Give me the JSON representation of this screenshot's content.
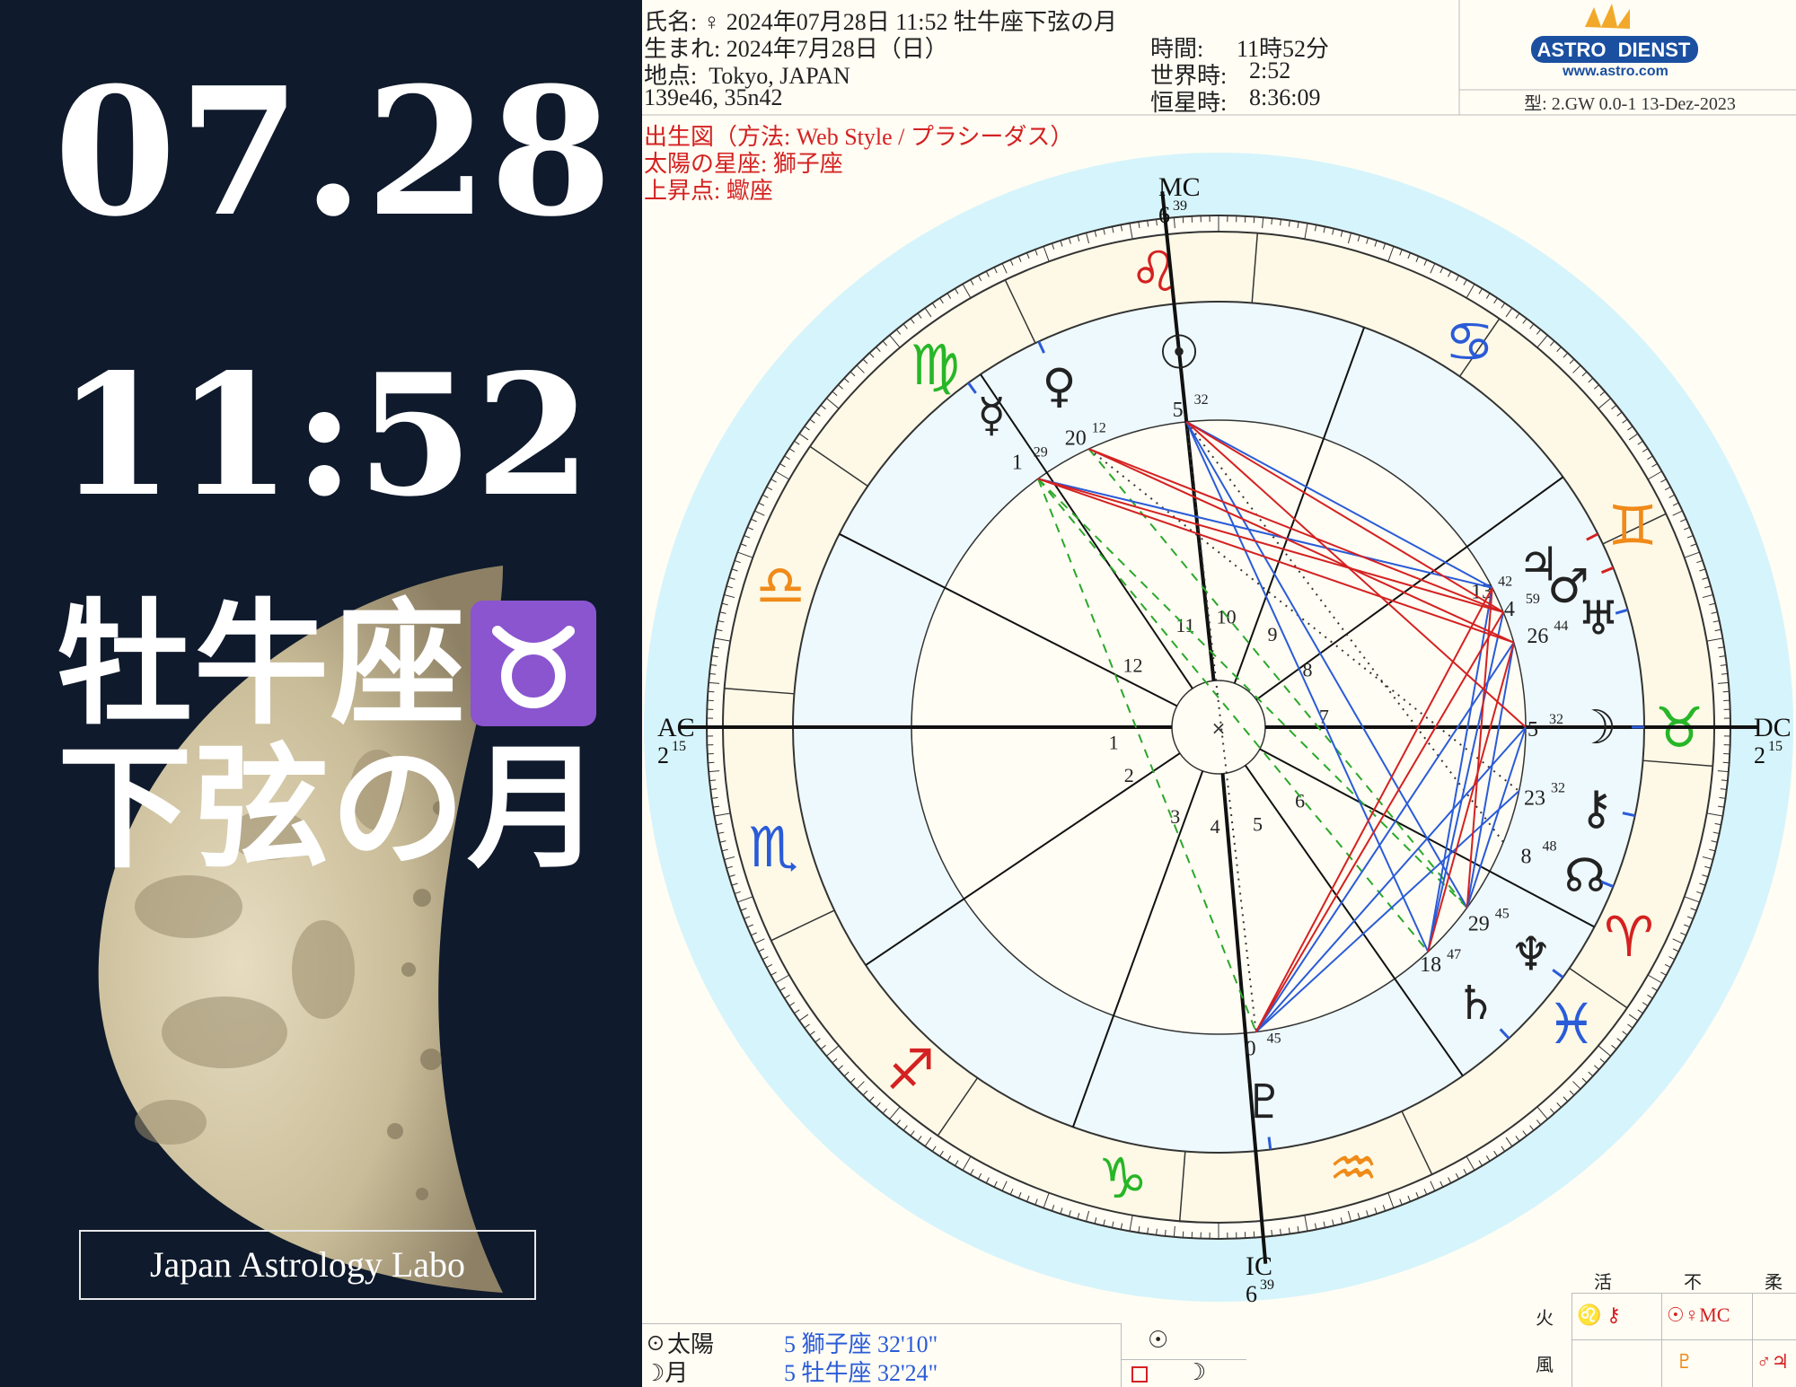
{
  "left": {
    "date": "07.28",
    "time": "11:52",
    "sign": "牡牛座",
    "sign_icon": "taurus-icon",
    "phase": "下弦の月",
    "brand": "Japan Astrology Labo"
  },
  "header": {
    "name_label": "氏名:",
    "name_value": "♀  2024年07月28日 11:52 牡牛座下弦の月",
    "born_label": "生まれ:",
    "born_value": "2024年7月28日（日）",
    "place_label": "地点:",
    "place_value": "Tokyo, JAPAN",
    "coords": "139e46, 35n42",
    "time_label": "時間:",
    "time_value": "11時52分",
    "ut_label": "世界時:",
    "ut_value": "2:52",
    "sidereal_label": "恒星時:",
    "sidereal_value": "8:36:09",
    "logo_left": "ASTRO",
    "logo_right": "DIENST",
    "logo_url": "www.astro.com",
    "type_line": "型: 2.GW   0.0-1   13-Dez-2023"
  },
  "chart_info": {
    "line1": "出生図（方法: Web Style / プラシーダス）",
    "line2": "太陽の星座: 獅子座",
    "line3": "上昇点: 蠍座"
  },
  "angles": {
    "mc_label": "MC",
    "mc_deg": "6",
    "mc_min": "39",
    "ic_label": "IC",
    "ic_deg": "6",
    "ic_min": "39",
    "ac_label": "AC",
    "ac_deg": "2",
    "ac_min": "15",
    "dc_label": "DC",
    "dc_deg": "2",
    "dc_min": "15"
  },
  "planets": [
    {
      "glyph": "☉",
      "deg": "5",
      "min": "32",
      "icon": "sun-icon"
    },
    {
      "glyph": "♀",
      "deg": "20",
      "min": "12",
      "icon": "venus-icon"
    },
    {
      "glyph": "☿",
      "deg": "1",
      "min": "29",
      "icon": "mercury-icon"
    },
    {
      "glyph": "♃",
      "deg": "13",
      "min": "42",
      "icon": "jupiter-icon"
    },
    {
      "glyph": "♂",
      "deg": "4",
      "min": "59",
      "icon": "mars-icon"
    },
    {
      "glyph": "♅",
      "deg": "26",
      "min": "44",
      "icon": "uranus-icon"
    },
    {
      "glyph": "☽",
      "deg": "5",
      "min": "32",
      "icon": "moon-icon"
    },
    {
      "glyph": "⚷",
      "deg": "23",
      "min": "32",
      "icon": "chiron-icon"
    },
    {
      "glyph": "☊",
      "deg": "8",
      "min": "48",
      "icon": "node-icon"
    },
    {
      "glyph": "♆",
      "deg": "29",
      "min": "45",
      "icon": "neptune-icon"
    },
    {
      "glyph": "♄",
      "deg": "18",
      "min": "47",
      "icon": "saturn-icon"
    },
    {
      "glyph": "♇",
      "deg": "0",
      "min": "45",
      "icon": "pluto-icon"
    }
  ],
  "houses": [
    "1",
    "2",
    "3",
    "4",
    "5",
    "6",
    "7",
    "8",
    "9",
    "10",
    "11",
    "12"
  ],
  "table": {
    "rows": [
      {
        "glyph": "☉",
        "name": "太陽",
        "pos": "5 獅子座 32'10\""
      },
      {
        "glyph": "☽",
        "name": "月",
        "pos": "5 牡牛座 32'24\""
      }
    ]
  },
  "elements": {
    "headers": [
      "活",
      "不",
      "柔"
    ],
    "fire_label": "火",
    "air_label": "風",
    "fire_cells": [
      "♌ ⚷",
      "☉♀MC",
      ""
    ],
    "air_cells": [
      "",
      "♇",
      "♂♃"
    ]
  },
  "colors": {
    "bg_dark": "#0f1a2c",
    "outer_ring": "#d6f4fb",
    "sign_ring": "#fdf9e6",
    "fire": "#d42121",
    "earth": "#27b627",
    "air": "#f08a18",
    "water": "#2a5bd8",
    "badge": "#8a55cf"
  }
}
